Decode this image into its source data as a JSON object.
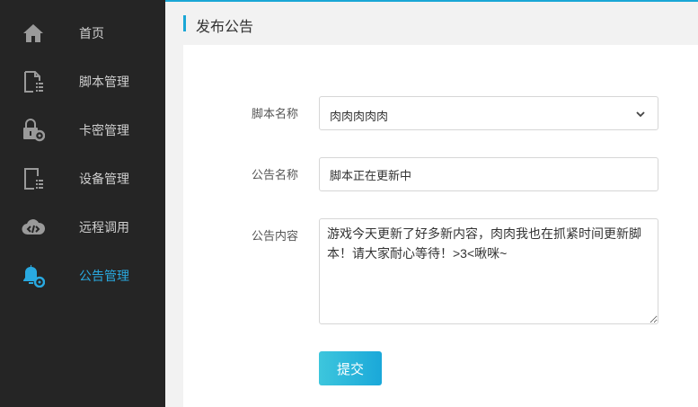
{
  "sidebar": {
    "items": [
      {
        "label": "首页",
        "icon": "home-icon"
      },
      {
        "label": "脚本管理",
        "icon": "document-list-icon"
      },
      {
        "label": "卡密管理",
        "icon": "lock-gear-icon"
      },
      {
        "label": "设备管理",
        "icon": "device-list-icon"
      },
      {
        "label": "远程调用",
        "icon": "cloud-code-icon"
      },
      {
        "label": "公告管理",
        "icon": "bell-gear-icon",
        "active": true
      }
    ]
  },
  "header": {
    "title": "发布公告"
  },
  "form": {
    "script_name_label": "脚本名称",
    "script_name_value": "肉肉肉肉肉",
    "notice_name_label": "公告名称",
    "notice_name_value": "脚本正在更新中",
    "notice_content_label": "公告内容",
    "notice_content_value": "游戏今天更新了好多新内容，肉肉我也在抓紧时间更新脚本！请大家耐心等待！>3<啾咪~",
    "submit_label": "提交"
  },
  "colors": {
    "accent": "#1aa7d6",
    "sidebar_bg": "#252525",
    "active_text": "#29a9e0"
  }
}
